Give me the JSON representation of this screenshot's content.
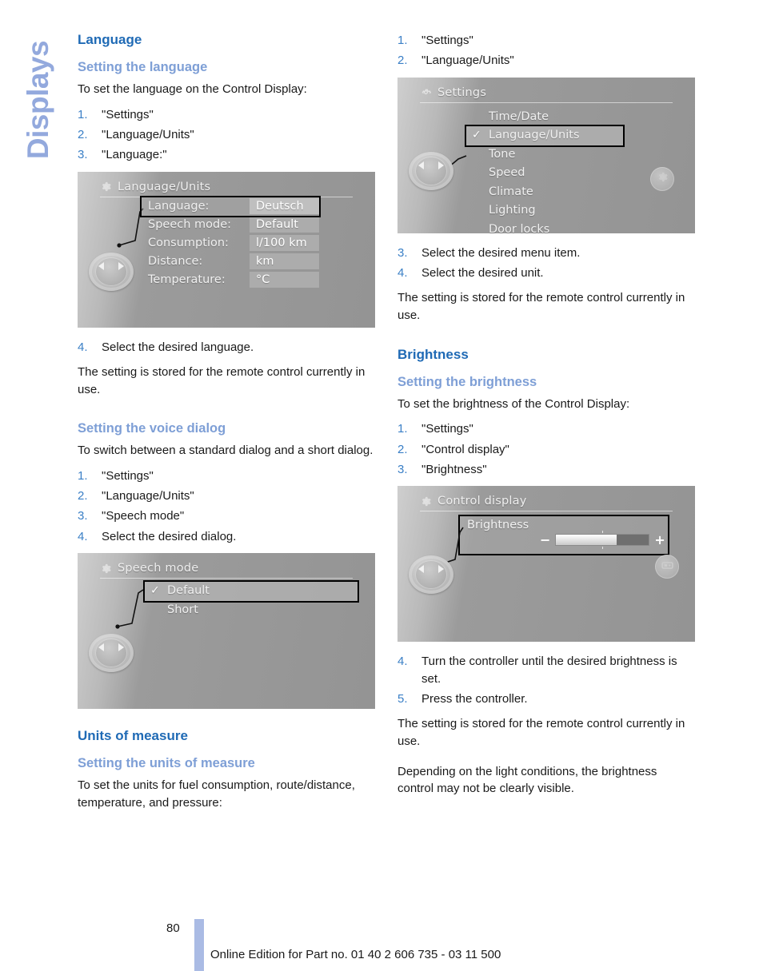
{
  "side_tab": {
    "label": "Displays",
    "color": "#93a9dd"
  },
  "colors": {
    "heading": "#1f6ab5",
    "subheading": "#7e9fd6",
    "step_number": "#3a7fc6",
    "footer_bar": "#aabbe4"
  },
  "left_column": {
    "section_title": "Language",
    "sub1_title": "Setting the language",
    "sub1_intro": "To set the language on the Control Display:",
    "sub1_steps": [
      {
        "num": "1.",
        "text": "\"Settings\""
      },
      {
        "num": "2.",
        "text": "\"Language/Units\""
      },
      {
        "num": "3.",
        "text": "\"Language:\""
      }
    ],
    "screen_lang_units": {
      "title": "Language/Units",
      "icon": "gear-icon",
      "rows": [
        {
          "key": "Language:",
          "value": "Deutsch",
          "selected": true
        },
        {
          "key": "Speech mode:",
          "value": "Default",
          "selected": false
        },
        {
          "key": "Consumption:",
          "value": "l/100 km",
          "selected": false
        },
        {
          "key": "Distance:",
          "value": "km",
          "selected": false
        },
        {
          "key": "Temperature:",
          "value": "°C",
          "selected": false
        }
      ]
    },
    "sub1_step4": {
      "num": "4.",
      "text": "Select the desired language."
    },
    "sub1_note": "The setting is stored for the remote control currently in use.",
    "sub2_title": "Setting the voice dialog",
    "sub2_intro": "To switch between a standard dialog and a short dialog.",
    "sub2_steps": [
      {
        "num": "1.",
        "text": "\"Settings\""
      },
      {
        "num": "2.",
        "text": "\"Language/Units\""
      },
      {
        "num": "3.",
        "text": "\"Speech mode\""
      },
      {
        "num": "4.",
        "text": "Select the desired dialog."
      }
    ],
    "screen_speech_mode": {
      "title": "Speech mode",
      "icon": "gear-icon",
      "items": [
        {
          "label": "Default",
          "selected": true,
          "checked": true
        },
        {
          "label": "Short",
          "selected": false,
          "checked": false
        }
      ]
    },
    "sub3_section_title": "Units of measure",
    "sub3_title": "Setting the units of measure",
    "sub3_intro": "To set the units for fuel consumption, route/distance, temperature, and pressure:"
  },
  "right_column": {
    "units_steps": [
      {
        "num": "1.",
        "text": "\"Settings\""
      },
      {
        "num": "2.",
        "text": "\"Language/Units\""
      }
    ],
    "screen_settings": {
      "title": "Settings",
      "icon": "gear-icon",
      "right_badge_icon": "gear-icon",
      "items": [
        {
          "label": "Time/Date",
          "selected": false,
          "checked": false
        },
        {
          "label": "Language/Units",
          "selected": true,
          "checked": true
        },
        {
          "label": "Tone",
          "selected": false,
          "checked": false
        },
        {
          "label": "Speed",
          "selected": false,
          "checked": false
        },
        {
          "label": "Climate",
          "selected": false,
          "checked": false
        },
        {
          "label": "Lighting",
          "selected": false,
          "checked": false
        },
        {
          "label": "Door locks",
          "selected": false,
          "checked": false
        }
      ]
    },
    "units_steps_after": [
      {
        "num": "3.",
        "text": "Select the desired menu item."
      },
      {
        "num": "4.",
        "text": "Select the desired unit."
      }
    ],
    "units_note": "The setting is stored for the remote control currently in use.",
    "brightness_section_title": "Brightness",
    "brightness_sub_title": "Setting the brightness",
    "brightness_intro": "To set the brightness of the Control Display:",
    "brightness_steps": [
      {
        "num": "1.",
        "text": "\"Settings\""
      },
      {
        "num": "2.",
        "text": "\"Control display\""
      },
      {
        "num": "3.",
        "text": "\"Brightness\""
      }
    ],
    "screen_control_display": {
      "title": "Control display",
      "icon": "gear-icon",
      "right_badge_icon": "monitor-icon",
      "setting_label": "Brightness",
      "minus_label": "−",
      "plus_label": "+",
      "slider_percent": 66
    },
    "brightness_steps_after": [
      {
        "num": "4.",
        "text": "Turn the controller until the desired brightness is set."
      },
      {
        "num": "5.",
        "text": "Press the controller."
      }
    ],
    "brightness_note1": "The setting is stored for the remote control currently in use.",
    "brightness_note2": "Depending on the light conditions, the brightness control may not be clearly visible."
  },
  "footer": {
    "page_number": "80",
    "text": "Online Edition for Part no. 01 40 2 606 735 - 03 11 500"
  }
}
